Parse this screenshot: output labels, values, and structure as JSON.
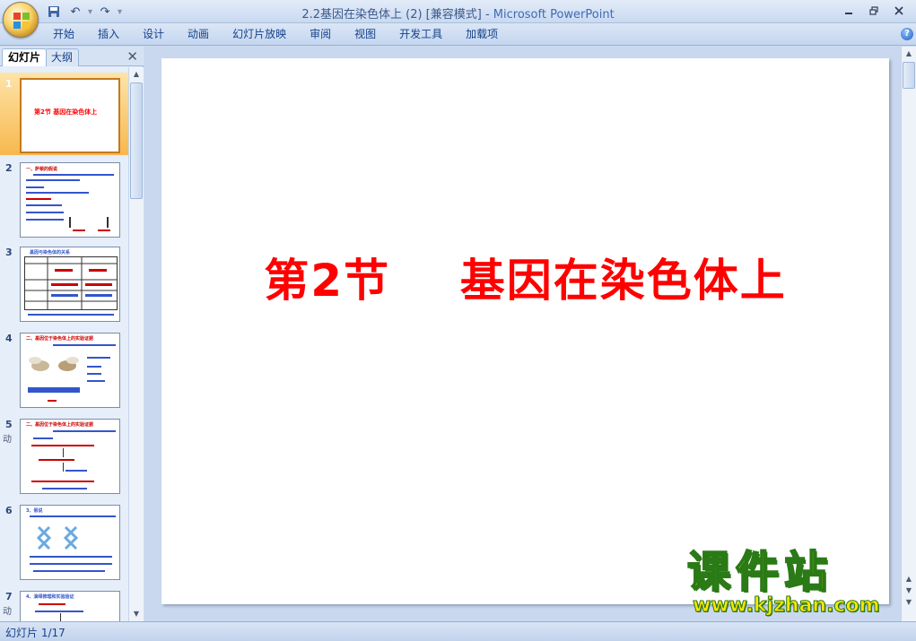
{
  "window": {
    "title_doc": "2.2基因在染色体上 (2) [兼容模式]",
    "title_sep": " - ",
    "title_app": "Microsoft PowerPoint",
    "minimize_icon": "minimize-icon",
    "restore_icon": "restore-icon",
    "close_icon": "close-icon"
  },
  "qat": {
    "save_icon": "save-icon",
    "undo_icon": "undo-icon",
    "redo_icon": "redo-icon",
    "customize_icon": "chevron-down-icon"
  },
  "ribbon": {
    "tabs": [
      "开始",
      "插入",
      "设计",
      "动画",
      "幻灯片放映",
      "审阅",
      "视图",
      "开发工具",
      "加载项"
    ],
    "help_glyph": "?"
  },
  "panel": {
    "tab_slides": "幻灯片",
    "tab_outline": "大纲",
    "close_glyph": "✕"
  },
  "thumbnails": [
    {
      "num": "1",
      "title": "第2节 基因在染色体上",
      "anim": ""
    },
    {
      "num": "2",
      "title": "一、萨顿的假说",
      "anim": ""
    },
    {
      "num": "3",
      "title": "基因与染色体的关系",
      "anim": ""
    },
    {
      "num": "4",
      "title": "二、基因位于染色体上的实验证据",
      "anim": ""
    },
    {
      "num": "5",
      "title": "二、基因位于染色体上的实验证据",
      "anim": "动"
    },
    {
      "num": "6",
      "title": "3、假说",
      "anim": ""
    },
    {
      "num": "7",
      "title": "4、演绎推理和实验验证",
      "anim": "动"
    }
  ],
  "slide": {
    "title": "第2节    基因在染色体上",
    "title_color": "#ff0000"
  },
  "status": {
    "slide_counter": "幻灯片 1/17"
  },
  "watermark": {
    "cn": "课件站",
    "url": "www.kjzhan.com"
  },
  "colors": {
    "accent": "#15428b",
    "selection": "#f7b84d",
    "watermark_fill": "#ffe600",
    "watermark_stroke": "#2a7a16"
  }
}
